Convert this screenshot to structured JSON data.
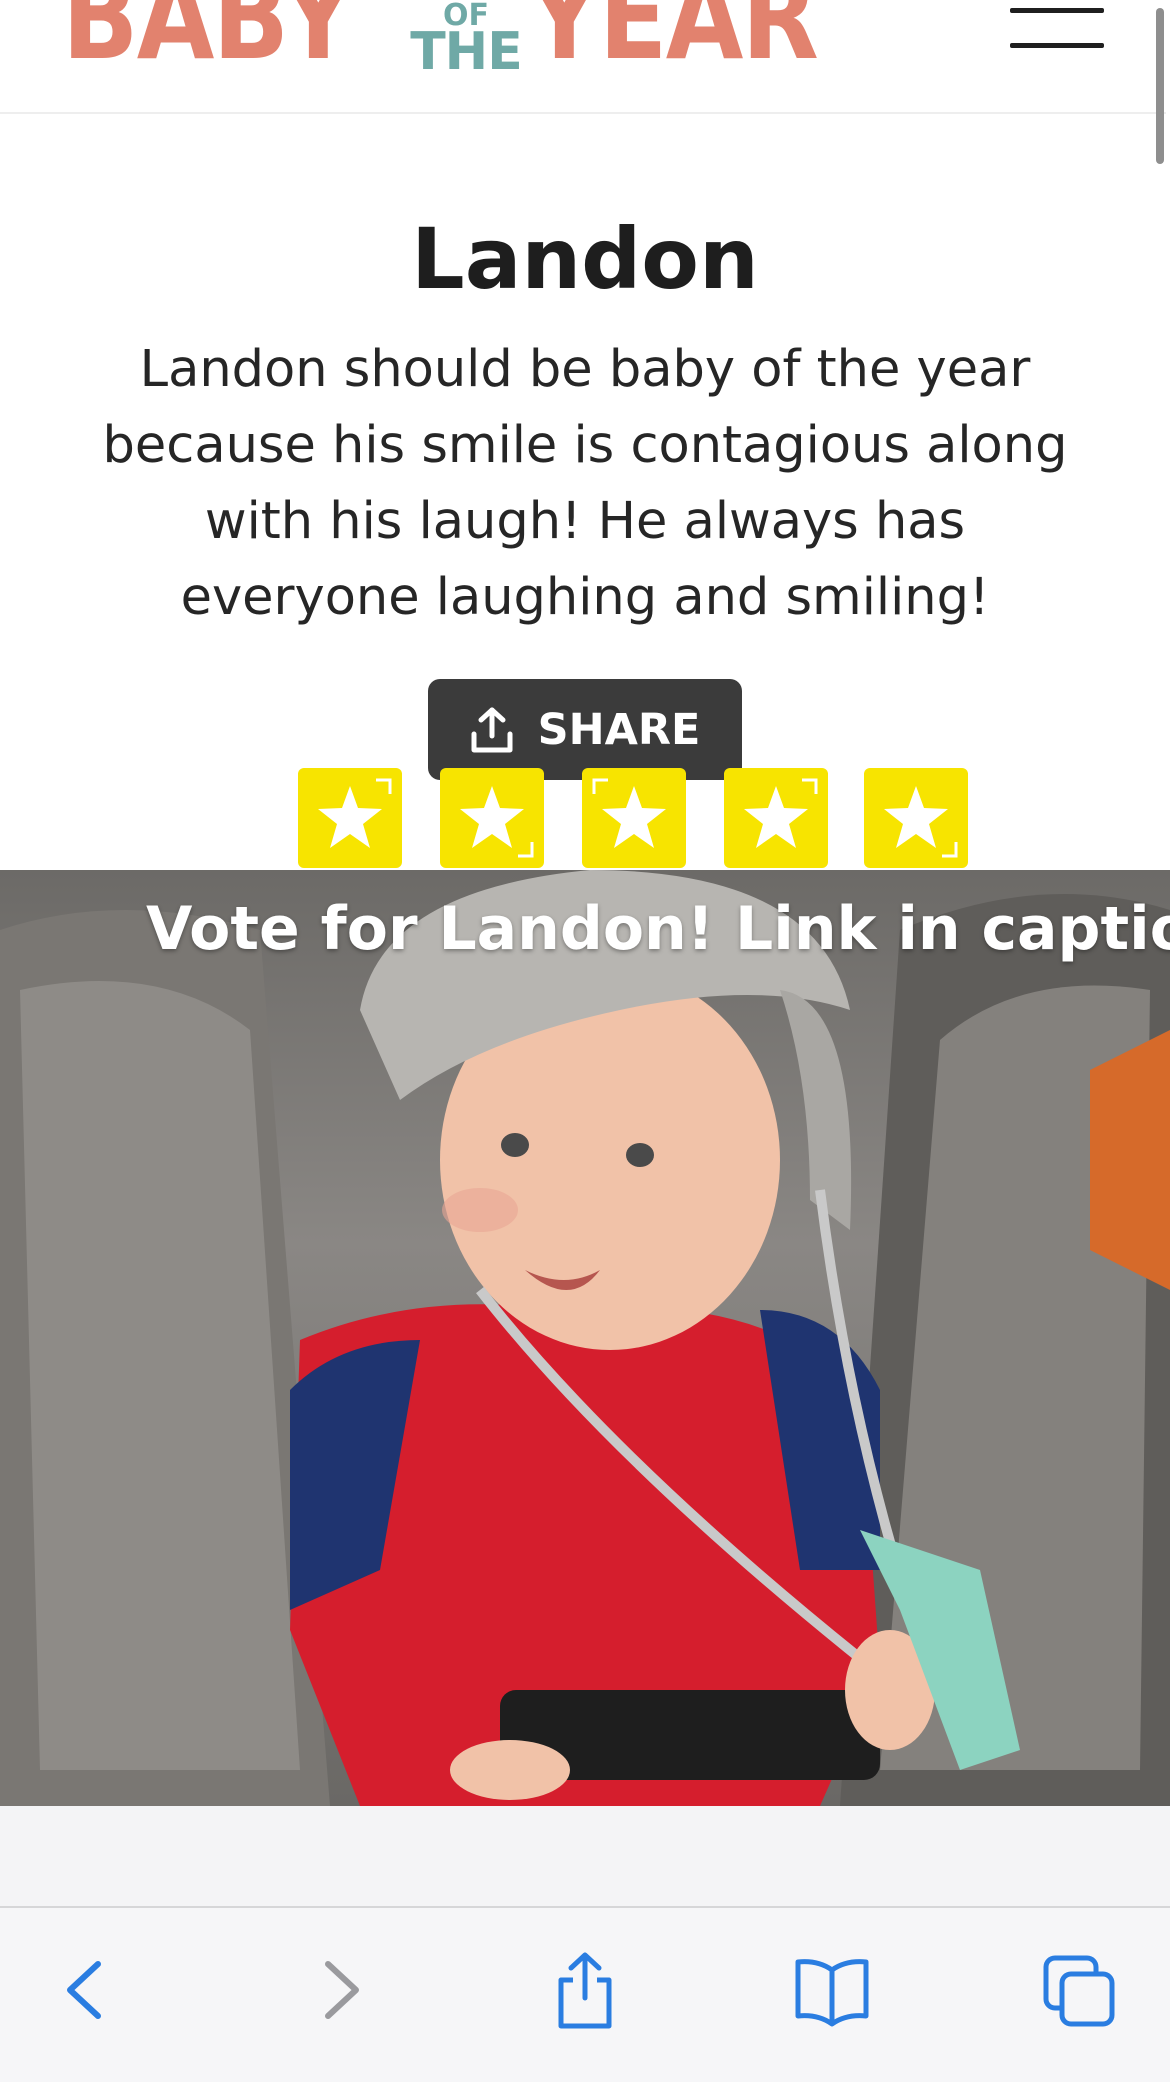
{
  "header": {
    "logo": {
      "baby": "BABY",
      "of": "OF",
      "the": "THE",
      "year": "YEAR"
    },
    "menu_icon": "hamburger-menu-icon"
  },
  "entry": {
    "name": "Landon",
    "description": "Landon should be baby of the year because his smile is contagious along with his laugh! He always has everyone laughing and smiling!",
    "share_label": "SHARE",
    "rating_stars": 5
  },
  "photo": {
    "caption": "Vote for Landon! Link in caption!"
  },
  "toolbar": {
    "items": [
      "back-icon",
      "forward-icon",
      "share-icon",
      "bookmarks-icon",
      "tabs-icon"
    ]
  },
  "colors": {
    "logo_coral": "#e2826e",
    "logo_teal": "#6fa9a6",
    "star_yellow": "#f7e400",
    "share_bg": "#3b3b3b",
    "ios_blue": "#2a7de1"
  }
}
